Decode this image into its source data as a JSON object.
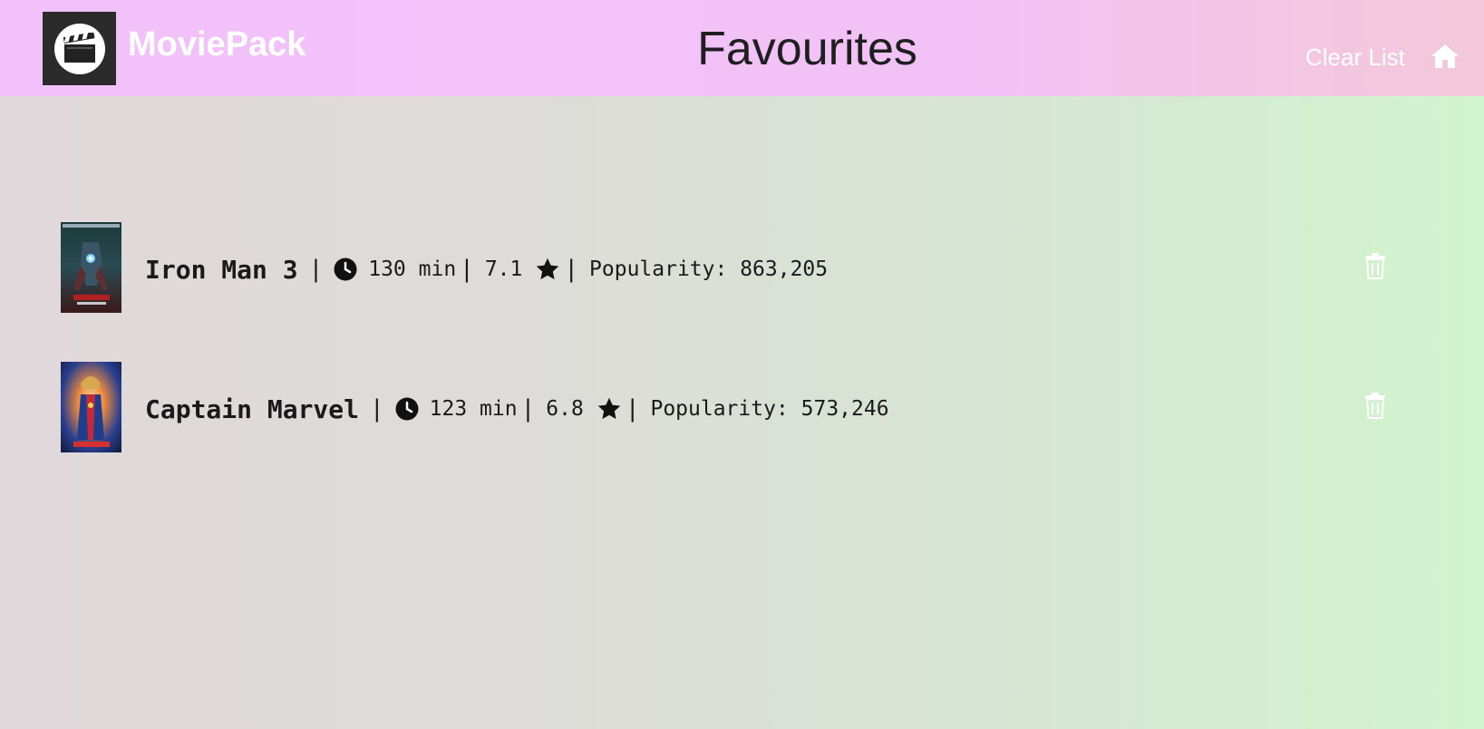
{
  "header": {
    "brand": "MoviePack",
    "title": "Favourites",
    "clear_label": "Clear List",
    "logo_icon": "clapperboard-icon",
    "home_icon": "home-icon"
  },
  "movies": [
    {
      "title": "Iron Man 3",
      "runtime": "130 min",
      "rating": "7.1",
      "popularity": "Popularity: 863,205"
    },
    {
      "title": "Captain Marvel",
      "runtime": "123 min",
      "rating": "6.8",
      "popularity": "Popularity: 573,246"
    }
  ],
  "colors": {
    "header_bg": "#f2c1fb",
    "body_left": "#e0d8da",
    "body_right": "#d0f4cd"
  },
  "icons": {
    "runtime": "clock-icon",
    "rating": "star-icon",
    "remove": "trash-icon"
  }
}
